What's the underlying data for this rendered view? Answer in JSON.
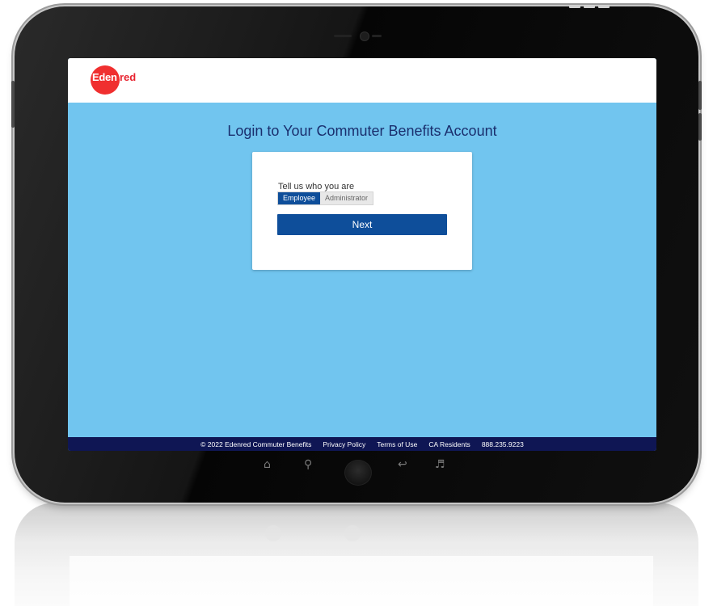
{
  "brand": {
    "logo_text": "Eden",
    "logo_text_tail": "red",
    "logo_color": "#f02f2f"
  },
  "page": {
    "title": "Login to Your Commuter Benefits Account"
  },
  "form": {
    "prompt": "Tell us who you are",
    "role_options": [
      "Employee",
      "Administrator"
    ],
    "selected_role": "Employee",
    "next_label": "Next"
  },
  "footer": {
    "copyright": "© 2022 Edenred Commuter Benefits",
    "links": [
      "Privacy Policy",
      "Terms of Use",
      "CA Residents"
    ],
    "phone": "888.235.9223"
  },
  "colors": {
    "background": "#71c5ef",
    "primary": "#0e4e9a",
    "title": "#1a2f6e",
    "footer": "#0f1654"
  },
  "device_nav": {
    "icons": [
      "home-icon",
      "search-icon",
      "home-button",
      "back-icon",
      "volume-icon"
    ]
  }
}
